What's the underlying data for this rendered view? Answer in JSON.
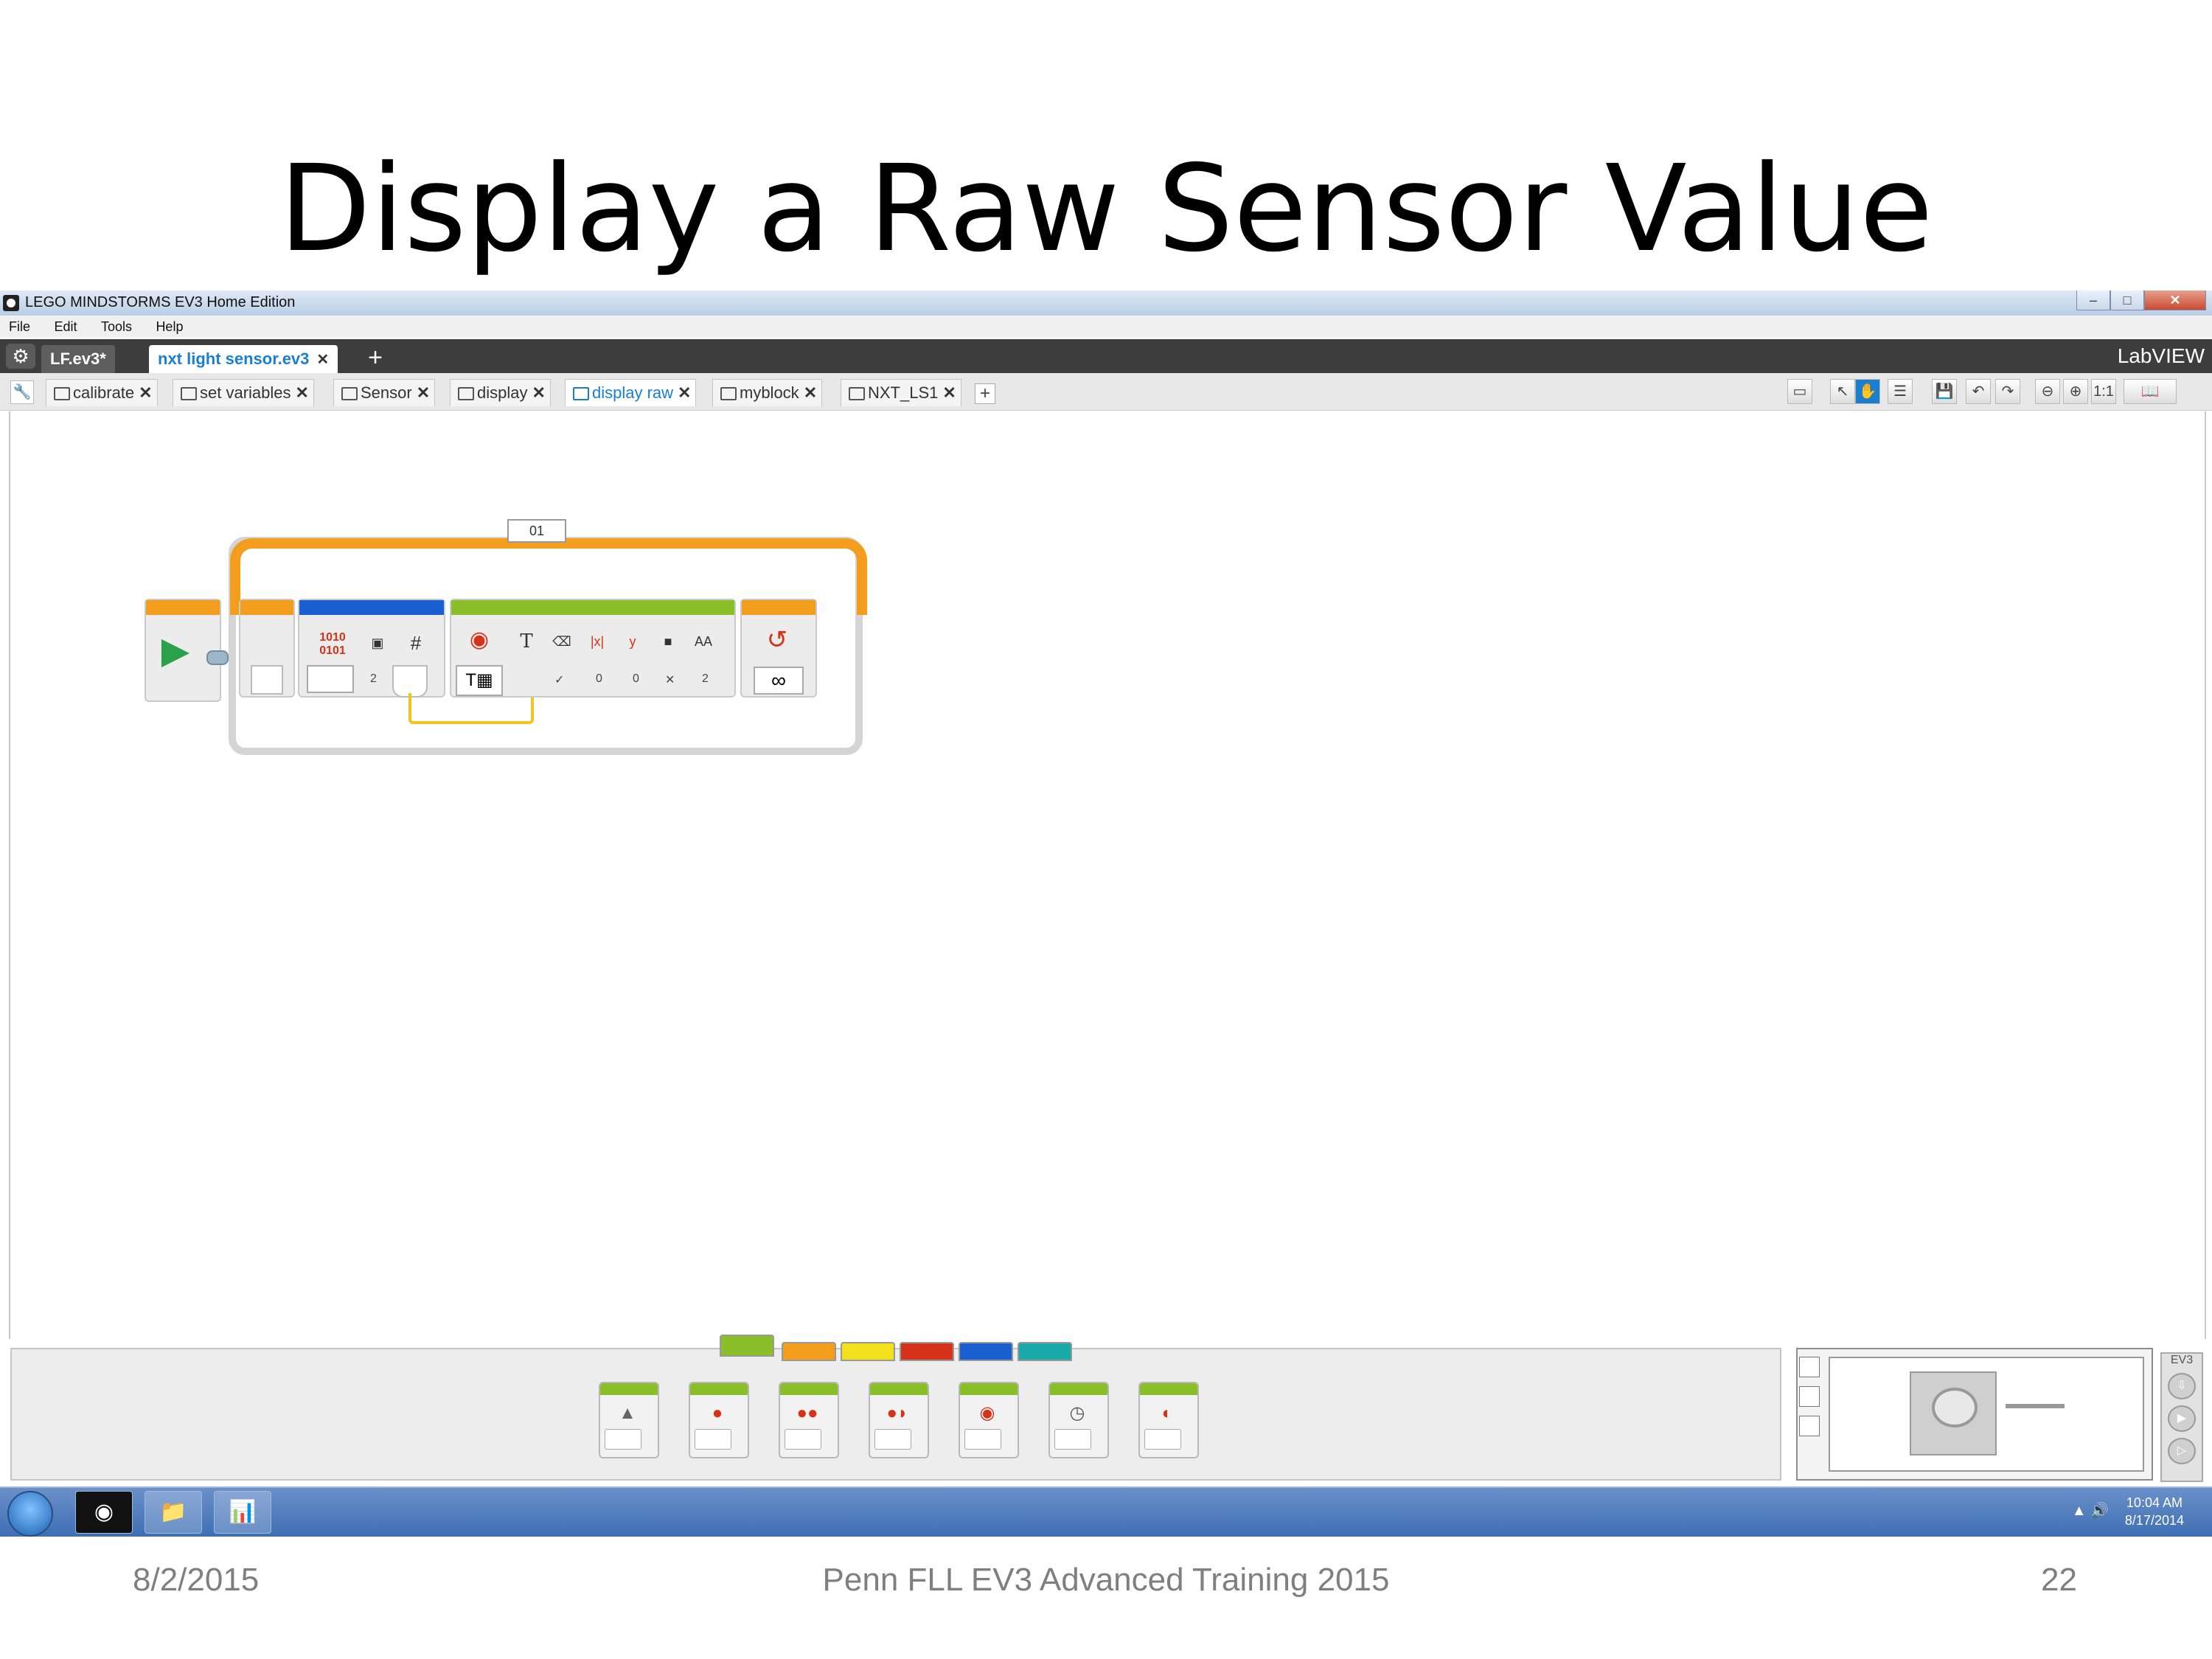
{
  "slide": {
    "title": "Display a Raw Sensor Value",
    "date": "8/2/2015",
    "footer": "Penn FLL EV3 Advanced Training 2015",
    "page": "22"
  },
  "window": {
    "title": "LEGO MINDSTORMS EV3 Home Edition",
    "minimize": "–",
    "maximize": "□",
    "close": "✕"
  },
  "menu": [
    "File",
    "Edit",
    "Tools",
    "Help"
  ],
  "projects": {
    "tabs": [
      {
        "label": "LF.ev3*",
        "active": false
      },
      {
        "label": "nxt light sensor.ev3",
        "active": true
      }
    ],
    "add": "+",
    "brand": "LabVIEW"
  },
  "programs": {
    "tabs": [
      {
        "label": "calibrate",
        "active": false
      },
      {
        "label": "set variables",
        "active": false
      },
      {
        "label": "Sensor",
        "active": false
      },
      {
        "label": "display",
        "active": false
      },
      {
        "label": "display raw",
        "active": true
      },
      {
        "label": "myblock",
        "active": false
      },
      {
        "label": "NXT_LS1",
        "active": false
      }
    ],
    "add": "+",
    "tools": [
      "comment",
      "select",
      "pan",
      "content",
      "save",
      "undo",
      "redo",
      "zoom-out",
      "zoom-in",
      "zoom-1-1",
      "content-editor"
    ],
    "zoom_label": "1:1"
  },
  "program": {
    "loop_label": "01",
    "raw_block": {
      "top": "1010",
      "bottom": "0101",
      "port": "2"
    },
    "display_block": {
      "params": [
        "✓",
        "0",
        "0",
        "✕",
        "2"
      ]
    },
    "loop_end": {
      "mode": "∞"
    }
  },
  "palette": {
    "category_colors": [
      "#8bbf2a",
      "#f29d1e",
      "#f2e01c",
      "#d6321a",
      "#1a5fd0",
      "#1aa9a9"
    ],
    "blocks": [
      "brick-buttons",
      "color-sensor",
      "gyro-sensor",
      "infrared-sensor",
      "motor-rotation",
      "timer",
      "touch-sensor"
    ]
  },
  "hardware": {
    "side_label": "EV3"
  },
  "taskbar": {
    "time": "10:04 AM",
    "date": "8/17/2014"
  }
}
